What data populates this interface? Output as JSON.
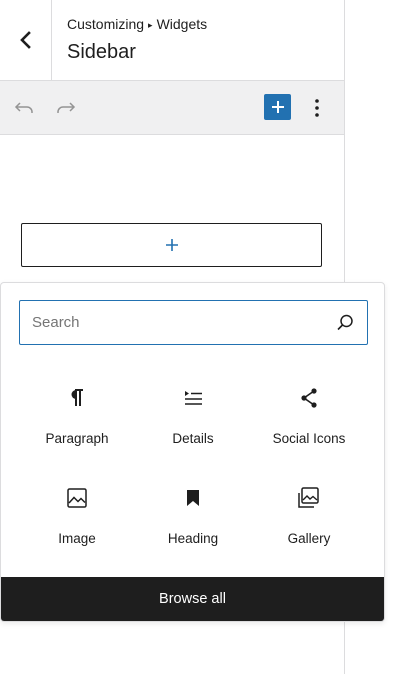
{
  "header": {
    "breadcrumb_root": "Customizing",
    "breadcrumb_separator": "▸",
    "breadcrumb_current": "Widgets",
    "title": "Sidebar"
  },
  "toolbar": {
    "undo_icon": "undo-icon",
    "redo_icon": "redo-icon",
    "inserter_icon": "plus-icon",
    "more_icon": "vertical-ellipsis-icon",
    "accent_color": "#2271b1"
  },
  "appender": {
    "symbol": "+"
  },
  "inserter": {
    "search_placeholder": "Search",
    "blocks": [
      {
        "label": "Paragraph",
        "icon": "paragraph-icon"
      },
      {
        "label": "Details",
        "icon": "details-icon"
      },
      {
        "label": "Social Icons",
        "icon": "share-icon"
      },
      {
        "label": "Image",
        "icon": "image-icon"
      },
      {
        "label": "Heading",
        "icon": "bookmark-icon"
      },
      {
        "label": "Gallery",
        "icon": "gallery-icon"
      }
    ],
    "browse_all_label": "Browse all"
  }
}
